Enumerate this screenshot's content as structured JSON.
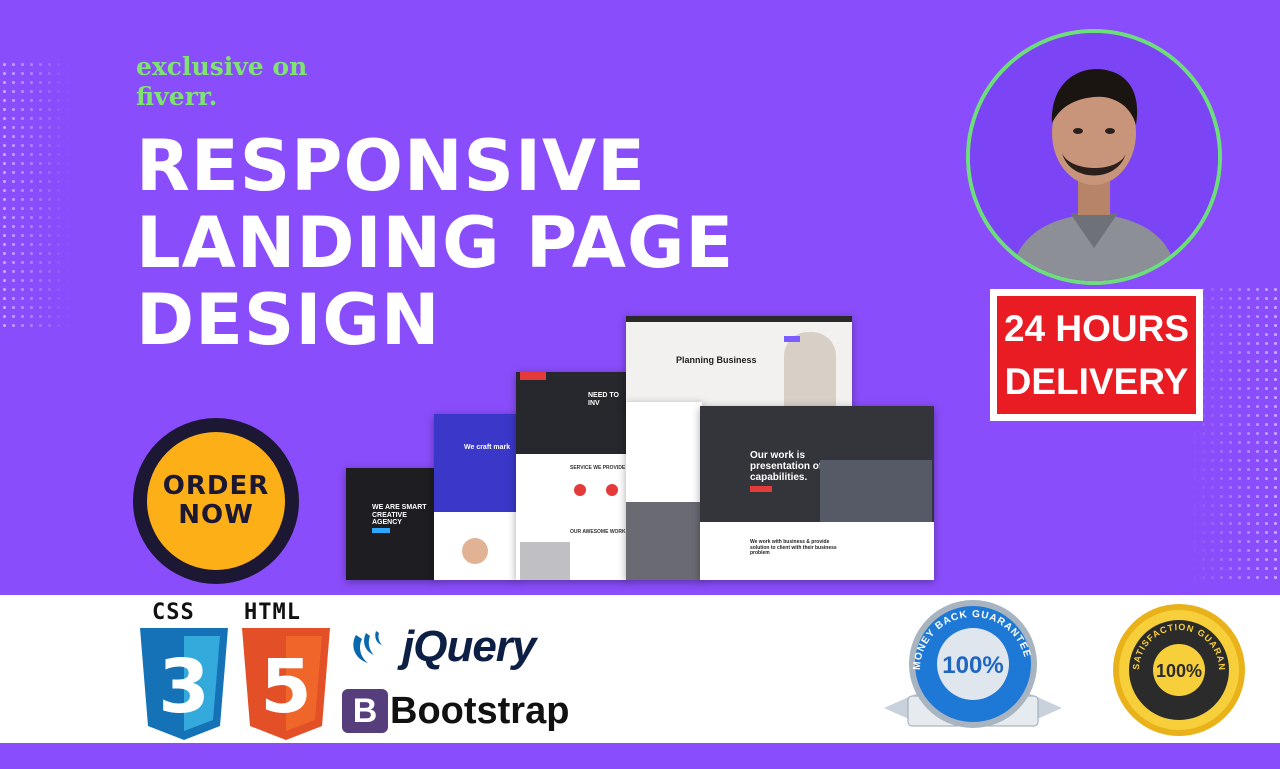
{
  "tagline": {
    "line1": "exclusive on",
    "line2": "fiverr."
  },
  "headline": {
    "line1": "RESPONSIVE",
    "line2": "LANDING PAGE",
    "line3": "DESIGN"
  },
  "order_badge": {
    "line1": "ORDER",
    "line2": "NOW"
  },
  "delivery_badge": {
    "line1": "24 HOURS",
    "line2": "DELIVERY"
  },
  "mockups": {
    "planning": "Planning Business",
    "work": "Our work is presentation of our capabilities.",
    "work_sub": "We work with business & provide solution to client with their business problem",
    "creative": "WE ARE SMART CREATIVE AGENCY",
    "service": "SERVICE WE PROVIDE",
    "need": "NEED TO INV",
    "awesome": "OUR AWESOME WORK",
    "craft": "We craft mark"
  },
  "tech": {
    "css": "CSS",
    "html": "HTML",
    "css_num": "3",
    "html_num": "5",
    "jquery": "jQuery",
    "bootstrap_letter": "B",
    "bootstrap": "Bootstrap"
  },
  "seals": {
    "money_back": "100%",
    "money_back_ring": "MONEY BACK GUARANTEE",
    "satisfaction": "100%",
    "satisfaction_ring": "SATISFACTION GUARANTEE"
  },
  "colors": {
    "background": "#8a4dfb",
    "accent_green": "#7ee36f",
    "order_yellow": "#fcaf17",
    "delivery_red": "#e91b23"
  }
}
